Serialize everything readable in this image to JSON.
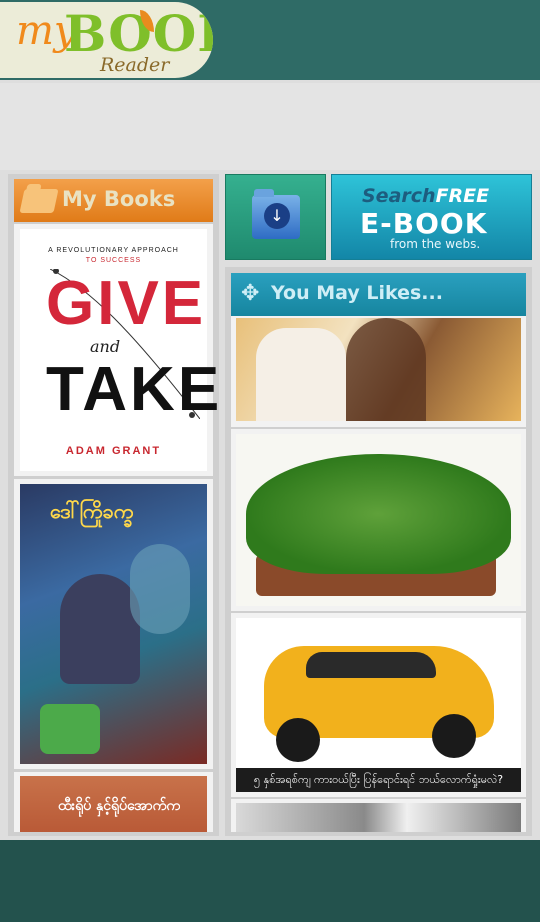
{
  "header": {
    "logo_my": "my",
    "logo_book": "BOOK",
    "logo_reader": "Reader"
  },
  "my_books": {
    "title": "My Books",
    "books": [
      {
        "series": "A REVOLUTIONARY APPROACH",
        "series2": "TO SUCCESS",
        "title_give": "GIVE",
        "title_and": "and",
        "title_take": "TAKE",
        "author": "ADAM GRANT"
      },
      {
        "title": "ဒေါ်ကြိုခက္ခ"
      },
      {
        "title": "ထီးရိုပ် နှင့်ရိုပ်အောက်က"
      }
    ]
  },
  "actions": {
    "download_icon": "download-folder-icon",
    "search_line1_a": "Search",
    "search_line1_b": "FREE",
    "search_line2": "E-BOOK",
    "search_line3": "from the webs."
  },
  "you_may_likes": {
    "title": "You May Likes...",
    "items": [
      {
        "image": "couple-sunset-photo"
      },
      {
        "image": "leafy-greens-basket-photo"
      },
      {
        "image": "yellow-suv-photo",
        "caption": "၅ နှစ်အရစ်ကျ ကားဝယ်ပြီး ပြန်ရောင်းရင် ဘယ်လောက်ရှုံးမလဲ?"
      },
      {
        "image": "interior-photo"
      }
    ]
  },
  "colors": {
    "header_bg": "#2f6b66",
    "my_books_header": "#e98a24",
    "you_may_likes_header": "#1f94b3",
    "footer_bg": "#23524d"
  }
}
